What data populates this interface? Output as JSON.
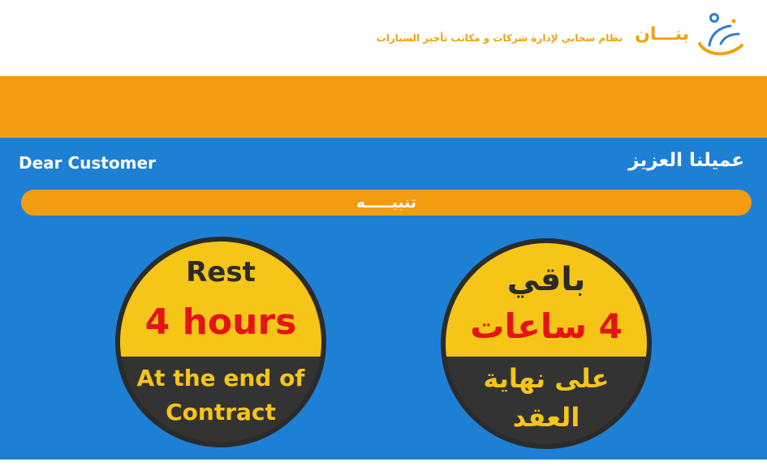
{
  "header": {
    "brand": "بنـــان",
    "tagline": "نظام سحابي لإدارة شركات و مكاتب تأجير السيارات",
    "logo_icon": "banan-logo-icon"
  },
  "colors": {
    "orange": "#f39c12",
    "blue": "#1e80d4",
    "badge_yellow": "#f5c518",
    "badge_dark": "#2b2b2b",
    "accent_red": "#e41414"
  },
  "greeting": {
    "en": "Dear Customer",
    "ar": "عميلنا العزيز"
  },
  "alert": {
    "label": "تنبيـــــه"
  },
  "badge_en": {
    "line1": "Rest",
    "line2": "4 hours",
    "line3": "At the end of",
    "line4": "Contract"
  },
  "badge_ar": {
    "line1": "باقي",
    "line2": "4 ساعات",
    "line3": "على نهاية",
    "line4": "العقد"
  }
}
